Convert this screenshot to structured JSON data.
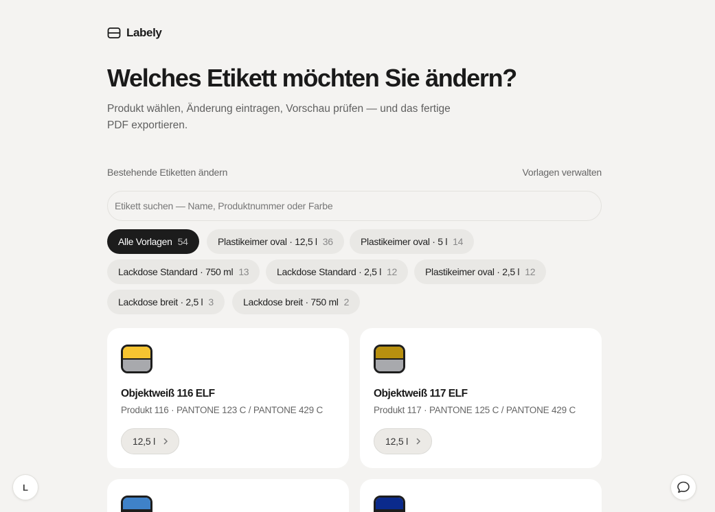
{
  "brand": {
    "name": "Labely",
    "icon": "label-icon"
  },
  "page": {
    "title": "Welches Etikett möchten Sie ändern?",
    "subtitle": "Produkt wählen, Änderung eintragen, Vorschau prüfen — und das fertige PDF exportieren."
  },
  "section": {
    "title": "Bestehende Etiketten ändern",
    "manage_link": "Vorlagen verwalten"
  },
  "search": {
    "placeholder": "Etikett suchen — Name, Produktnummer oder Farbe",
    "value": ""
  },
  "filters": [
    {
      "label": "Alle Vorlagen",
      "count": "54",
      "active": true
    },
    {
      "label": "Plastikeimer oval · 12,5 l",
      "count": "36"
    },
    {
      "label": "Plastikeimer oval · 5 l",
      "count": "14"
    },
    {
      "label": "Lackdose Standard · 750 ml",
      "count": "13"
    },
    {
      "label": "Lackdose Standard · 2,5 l",
      "count": "12"
    },
    {
      "label": "Plastikeimer oval · 2,5 l",
      "count": "12"
    },
    {
      "label": "Lackdose breit · 2,5 l",
      "count": "3"
    },
    {
      "label": "Lackdose breit · 750 ml",
      "count": "2"
    }
  ],
  "cards": [
    {
      "name": "Objektweiß 116 ELF",
      "meta": "Produkt 116 · PANTONE 123 C / PANTONE 429 C",
      "size": "12,5 l",
      "color_top": "#f6c431",
      "color_bottom": "#a8a9ad"
    },
    {
      "name": "Objektweiß 117 ELF",
      "meta": "Produkt 117 · PANTONE 125 C / PANTONE 429 C",
      "size": "12,5 l",
      "color_top": "#b8900f",
      "color_bottom": "#a8a9ad"
    },
    {
      "name": "",
      "meta": "",
      "size": "",
      "color_top": "#3f82c9",
      "color_bottom": "#1d1d1d"
    },
    {
      "name": "",
      "meta": "",
      "size": "",
      "color_top": "#0b2a8c",
      "color_bottom": "#1d1d1d"
    }
  ],
  "fab_left": {
    "label": "L"
  },
  "fab_right": {
    "icon": "chat-bubble-icon"
  }
}
